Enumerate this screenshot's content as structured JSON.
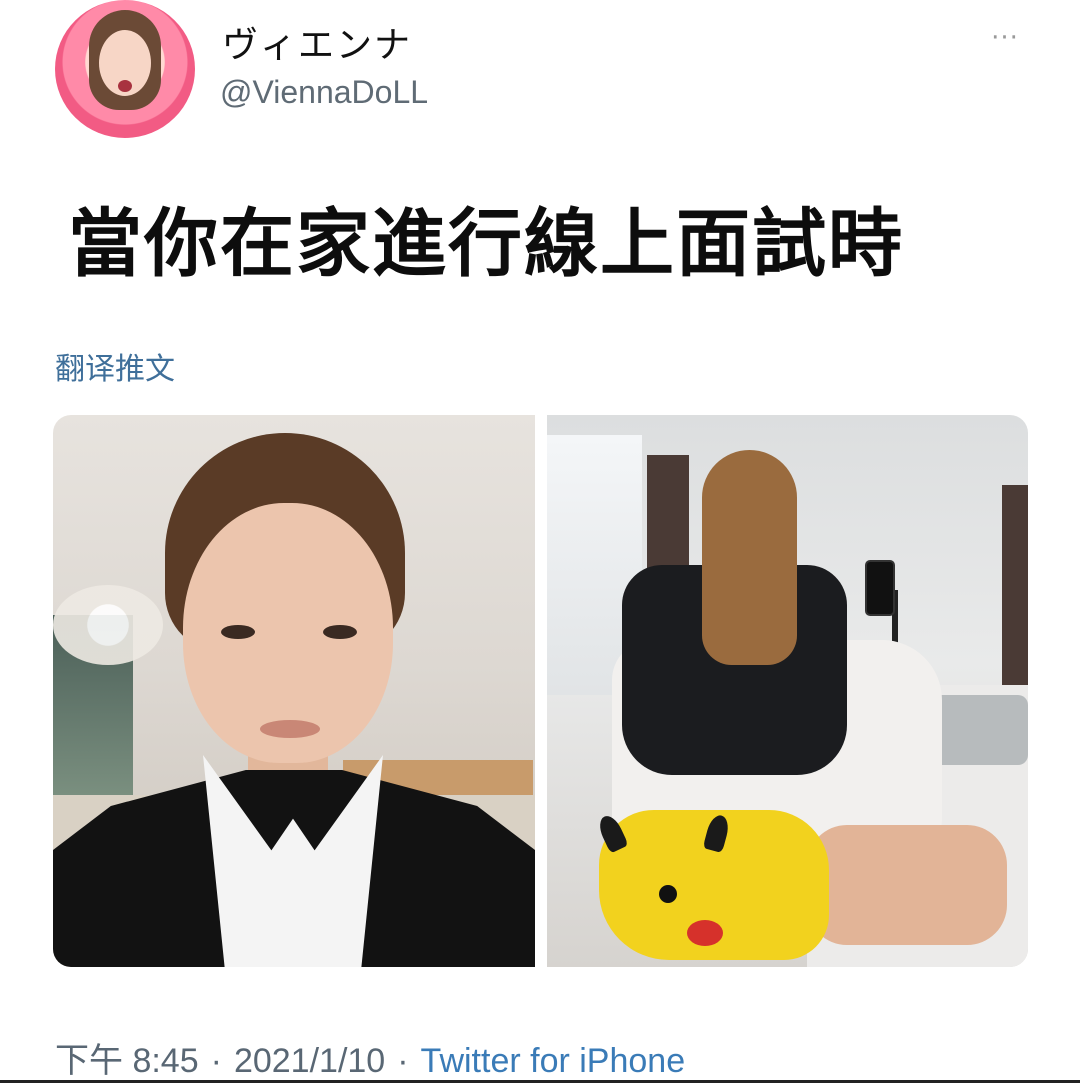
{
  "author": {
    "display_name": "ヴィエンナ",
    "handle": "@ViennaDoLL",
    "avatar_icon": "profile-avatar"
  },
  "more_menu": {
    "label": "···",
    "icon": "more-dots-icon"
  },
  "tweet": {
    "text": "當你在家進行線上面試時",
    "translate_label": "翻译推文"
  },
  "media": {
    "images": [
      {
        "subject": "woman in blazer on video call"
      },
      {
        "subject": "woman in pikachu shorts from behind"
      }
    ]
  },
  "footer": {
    "time": "下午 8:45",
    "separator": "·",
    "date": "2021/1/10",
    "source": "Twitter for iPhone"
  },
  "colors": {
    "link": "#3a7bb7",
    "muted": "#596774"
  }
}
